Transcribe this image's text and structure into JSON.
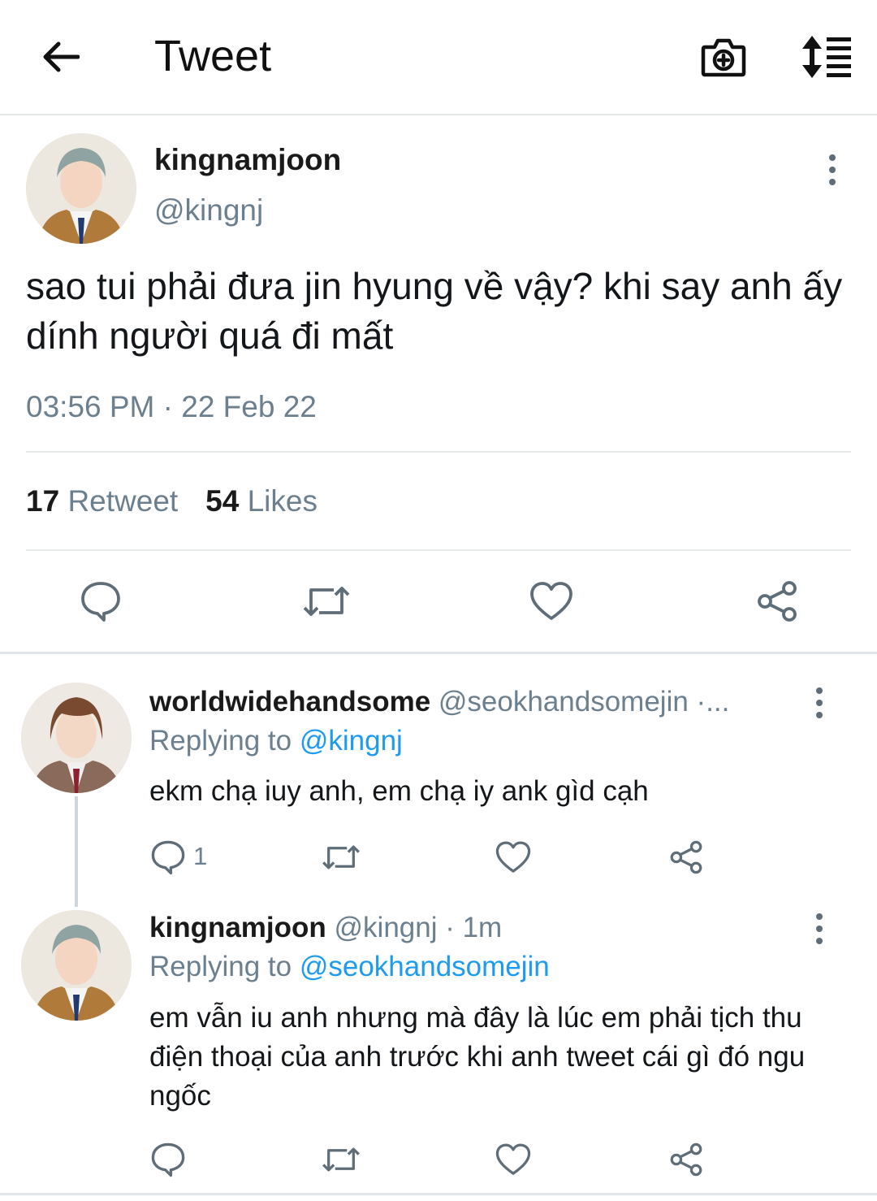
{
  "header": {
    "title": "Tweet"
  },
  "tweet": {
    "display_name": "kingnamjoon",
    "handle": "@kingnj",
    "text": "sao tui phải đưa jin hyung về vậy? khi say anh ấy dính người quá đi mất",
    "timestamp": "03:56 PM · 22 Feb 22",
    "retweet_count": "17",
    "retweet_label": "Retweet",
    "like_count": "54",
    "like_label": "Likes"
  },
  "replies": [
    {
      "display_name": "worldwidehandsome",
      "meta": "@seokhandsomejin ·...",
      "replying_prefix": "Replying to",
      "replying_to": "@kingnj",
      "text": "ekm chạ iuy anh, em chạ iy ank gìd cạh",
      "reply_count": "1"
    },
    {
      "display_name": "kingnamjoon",
      "meta": "@kingnj · 1m",
      "replying_prefix": "Replying to",
      "replying_to": "@seokhandsomejin",
      "text": "em vẫn iu anh nhưng mà đây là lúc em phải tịch thu điện thoại của anh trước khi anh tweet cái gì đó ngu ngốc"
    }
  ],
  "colors": {
    "accent": "#1d9bf0",
    "secondary_text": "#6b7f8f",
    "icon": "#5f6d78",
    "divider": "#e6e9ec"
  },
  "icons": [
    "back-arrow-icon",
    "camera-add-icon",
    "sort-icon",
    "more-vertical-icon",
    "reply-icon",
    "retweet-icon",
    "like-icon",
    "share-icon"
  ]
}
